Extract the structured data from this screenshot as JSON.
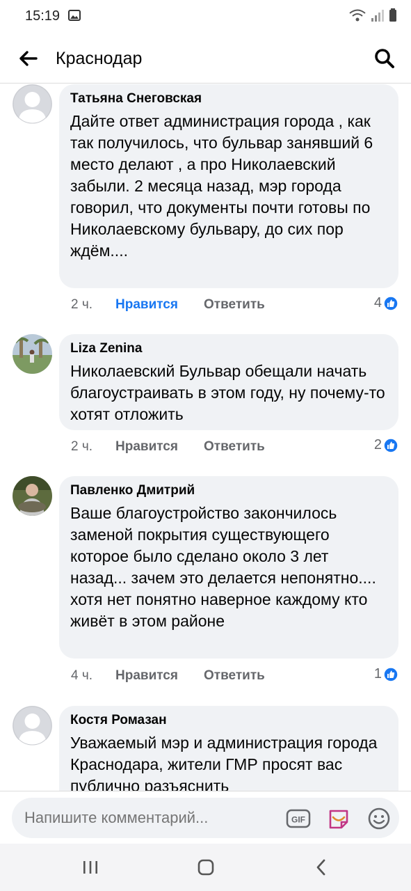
{
  "status": {
    "time": "15:19"
  },
  "header": {
    "title": "Краснодар"
  },
  "comments": [
    {
      "author": "Татьяна Снеговская",
      "text": "Дайте ответ администрация города , как так получилось, что бульвар занявший 6 место делают , а про Николаевский забыли.  2 месяца назад, мэр города говорил, что документы почти готовы по Николаевскому бульвару, до сих пор ждём....",
      "time": "2 ч.",
      "like": "Нравится",
      "reply": "Ответить",
      "reactions": "4"
    },
    {
      "author": "Liza Zenina",
      "text": "Николаевский Бульвар обещали начать благоустраивать в этом году, ну почему-то хотят отложить",
      "time": "2 ч.",
      "like": "Нравится",
      "reply": "Ответить",
      "reactions": "2"
    },
    {
      "author": "Павленко Дмитрий",
      "text": "Ваше благоустройство закончилось заменой покрытия существующего которое было сделано около 3 лет назад... зачем это делается непонятно.... хотя нет понятно наверное каждому кто живёт в этом районе",
      "time": "4 ч.",
      "like": "Нравится",
      "reply": "Ответить",
      "reactions": "1"
    },
    {
      "author": "Костя Ромазан",
      "text": "Уважаемый мэр и администрация города Краснодара, жители ГМР просят вас публично разъяснить"
    }
  ],
  "composer": {
    "placeholder": "Напишите комментарий..."
  },
  "colors": {
    "accent": "#1877f2",
    "bubble": "#f0f2f5",
    "muted": "#65676b"
  },
  "icons": [
    "back-arrow-icon",
    "search-icon",
    "like-reaction-icon",
    "gif-icon",
    "sticker-icon",
    "emoji-icon",
    "recent-apps-icon",
    "home-icon",
    "nav-back-icon"
  ]
}
